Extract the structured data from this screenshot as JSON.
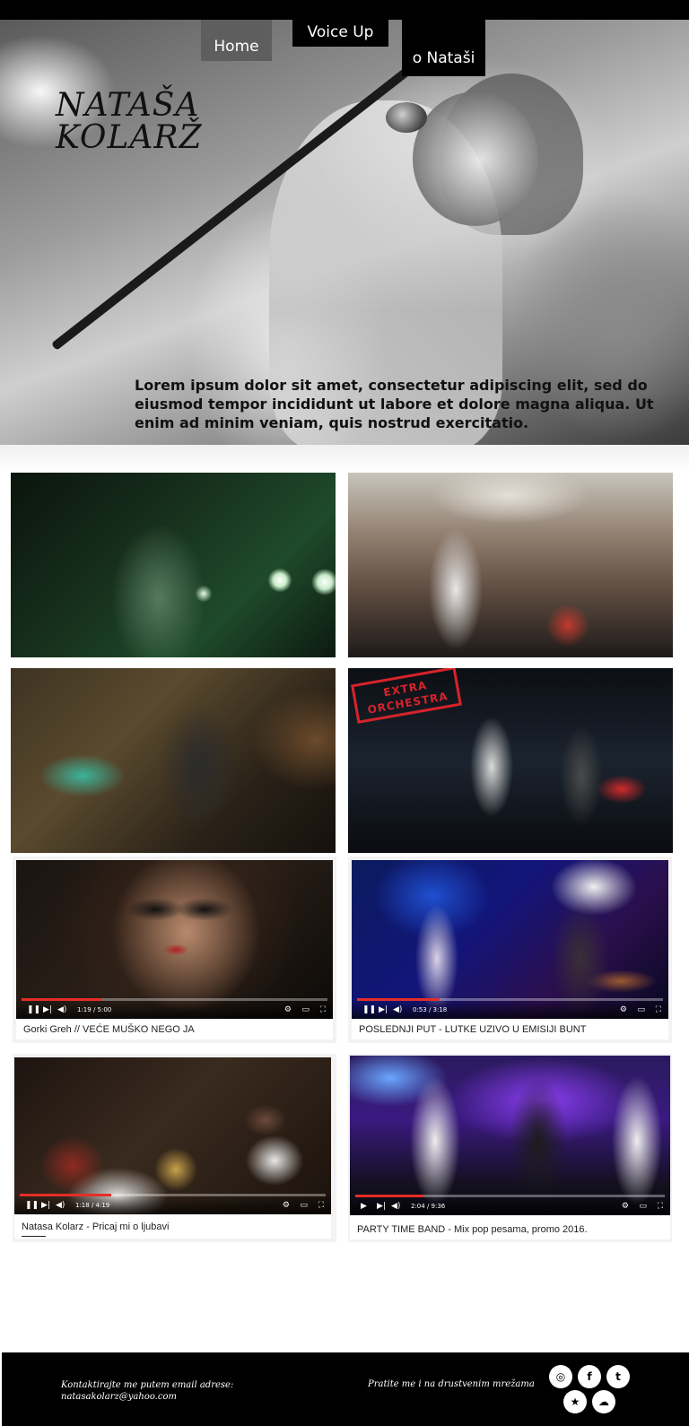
{
  "nav": {
    "home": "Home",
    "voice_up": "Voice Up",
    "o_natasi": "o Nataši"
  },
  "logo": {
    "line1": "NATAŠA",
    "line2": "KOLARŽ"
  },
  "hero": {
    "text": "Lorem ipsum dolor sit amet, consectetur adipiscing elit, sed do eiusmod tempor incididunt ut labore et dolore magna aliqua. Ut enim ad minim veniam, quis nostrud exercitatio."
  },
  "photos": {
    "stamp_text": "EXTRA ORCHESTRA"
  },
  "videos": [
    {
      "caption": "Gorki Greh // VEĆE MUŠKO NEGO JA",
      "time": "1:19 / 5:00",
      "progress": 0.26
    },
    {
      "caption": "POSLEDNJI PUT - LUTKE UZIVO U EMISIJI BUNT",
      "time": "0:53 / 3:18",
      "progress": 0.27
    },
    {
      "caption": "Natasa Kolarz - Pricaj mi o ljubavi",
      "time": "1:18 / 4:19",
      "progress": 0.3
    },
    {
      "caption": "PARTY TIME BAND - Mix pop pesama, promo 2016.",
      "time": "2:04 / 9:36",
      "progress": 0.22
    }
  ],
  "controls": {
    "play_icon": "▶",
    "pause_icon": "❚❚",
    "next_icon": "▶|",
    "volume_icon": "◀)",
    "settings_icon": "⚙",
    "theater_icon": "▭",
    "fullscreen_icon": "⛶"
  },
  "footer": {
    "contact_line1": "Kontaktirajte me putem email adrese:",
    "contact_line2": "natasakolarz@yahoo.com",
    "follow": "Pratite me i na drustvenim mrežama",
    "social": {
      "instagram": "◎",
      "facebook": "f",
      "twitter": "t",
      "star": "★",
      "soundcloud": "☁"
    }
  },
  "colors": {
    "accent_red": "#e52d27",
    "nav_home_bg": "#5e5e5e",
    "footer_bg": "#000000"
  }
}
